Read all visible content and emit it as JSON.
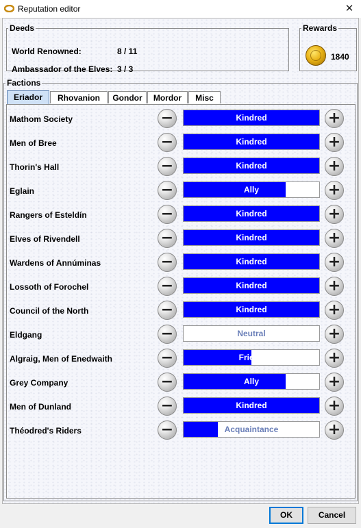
{
  "window": {
    "title": "Reputation editor",
    "close_label": "✕",
    "icon": "ring-icon"
  },
  "deeds": {
    "legend": "Deeds",
    "rows": [
      {
        "label": "World Renowned:",
        "value": "8 / 11"
      },
      {
        "label": "Ambassador of the Elves:",
        "value": "3 / 3"
      }
    ]
  },
  "rewards": {
    "legend": "Rewards",
    "value": "1840",
    "icon": "gold-coin-icon"
  },
  "factions": {
    "legend": "Factions",
    "tabs": [
      "Eriador",
      "Rhovanion",
      "Gondor",
      "Mordor",
      "Misc"
    ],
    "active_tab": "Eriador",
    "minus_label": "−",
    "plus_label": "+",
    "rows": [
      {
        "name": "Mathom Society",
        "level": "Kindred",
        "fill": 1.0
      },
      {
        "name": "Men of Bree",
        "level": "Kindred",
        "fill": 1.0
      },
      {
        "name": "Thorin's Hall",
        "level": "Kindred",
        "fill": 1.0
      },
      {
        "name": "Eglain",
        "level": "Ally",
        "fill": 0.75
      },
      {
        "name": "Rangers of Esteldín",
        "level": "Kindred",
        "fill": 1.0
      },
      {
        "name": "Elves of Rivendell",
        "level": "Kindred",
        "fill": 1.0
      },
      {
        "name": "Wardens of Annúminas",
        "level": "Kindred",
        "fill": 1.0
      },
      {
        "name": "Lossoth of Forochel",
        "level": "Kindred",
        "fill": 1.0
      },
      {
        "name": "Council of the North",
        "level": "Kindred",
        "fill": 1.0
      },
      {
        "name": "Eldgang",
        "level": "Neutral",
        "fill": 0.0
      },
      {
        "name": "Algraig, Men of Enedwaith",
        "level": "Friend",
        "fill": 0.5
      },
      {
        "name": "Grey Company",
        "level": "Ally",
        "fill": 0.75
      },
      {
        "name": "Men of Dunland",
        "level": "Kindred",
        "fill": 1.0
      },
      {
        "name": "Théodred's Riders",
        "level": "Acquaintance",
        "fill": 0.25
      }
    ]
  },
  "buttons": {
    "ok": "OK",
    "cancel": "Cancel"
  },
  "colors": {
    "bar_fill": "#0000ff",
    "active_tab": "#cfe1f6",
    "light_text": "#6a7fb8"
  }
}
